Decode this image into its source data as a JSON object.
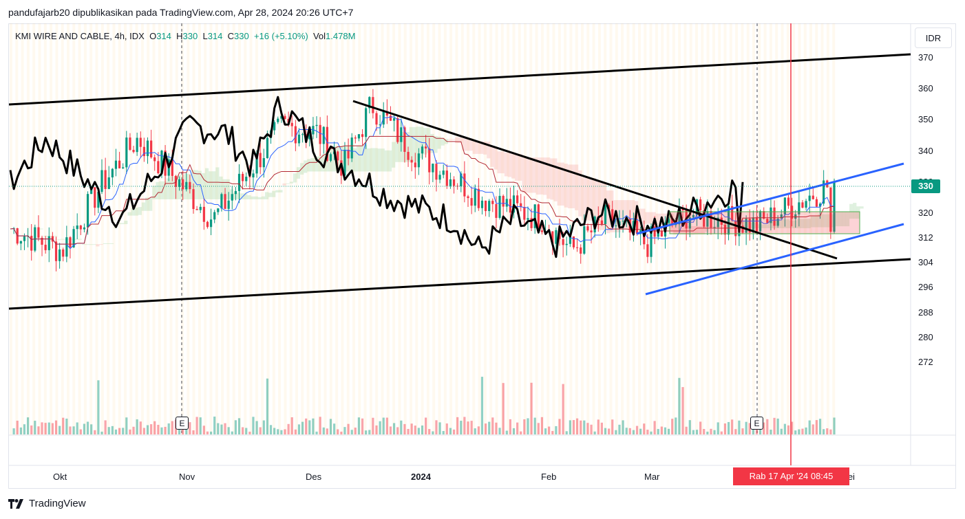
{
  "header": {
    "attribution": "pandufajarb20 dipublikasikan pada TradingView.com, Apr 28, 2024 20:26 UTC+7"
  },
  "legend": {
    "symbol": "KMI WIRE AND CABLE, 4h, IDX",
    "open_label": "O",
    "open": "314",
    "high_label": "H",
    "high": "330",
    "low_label": "L",
    "low": "314",
    "close_label": "C",
    "close": "330",
    "change": "+16 (+5.10%)",
    "vol_label": "Vol",
    "vol": "1.478M"
  },
  "currency": "IDR",
  "last_price_label": "330",
  "crosshair_date": "Rab 17 Apr '24   08:45",
  "earnings_marker": "E",
  "brand": "TradingView",
  "colors": {
    "up": "#089981",
    "down": "#f23645",
    "trendline": "#000000",
    "channel": "#2962ff",
    "cloud_up": "#a5d6a7",
    "cloud_down": "#f7a9a7"
  },
  "chart_data": {
    "type": "candlestick",
    "interval": "4h",
    "ylim": [
      264,
      374
    ],
    "y_ticks": [
      370,
      360,
      350,
      340,
      330,
      320,
      312,
      304,
      296,
      288,
      280,
      272
    ],
    "x_labels": [
      "Okt",
      "Nov",
      "Des",
      "2024",
      "Feb",
      "Mar",
      "Mei"
    ],
    "last": {
      "open": 314,
      "high": 330,
      "low": 314,
      "close": 330,
      "change": 16,
      "change_pct": 5.1,
      "volume": "1.478M"
    },
    "price_path_approx": [
      [
        "Okt",
        315
      ],
      [
        "Okt",
        308
      ],
      [
        "Okt",
        330
      ],
      [
        "Okt",
        344
      ],
      [
        "Nov",
        330
      ],
      [
        "Nov",
        318
      ],
      [
        "Nov",
        333
      ],
      [
        "Nov",
        348
      ],
      [
        "Des",
        346
      ],
      [
        "Des",
        335
      ],
      [
        "Des",
        355
      ],
      [
        "2024",
        340
      ],
      [
        "2024",
        333
      ],
      [
        "2024",
        325
      ],
      [
        "Feb",
        318
      ],
      [
        "Feb",
        308
      ],
      [
        "Feb",
        318
      ],
      [
        "Mar",
        310
      ],
      [
        "Mar",
        320
      ],
      [
        "Mar",
        316
      ],
      [
        "Mei",
        330
      ]
    ]
  }
}
